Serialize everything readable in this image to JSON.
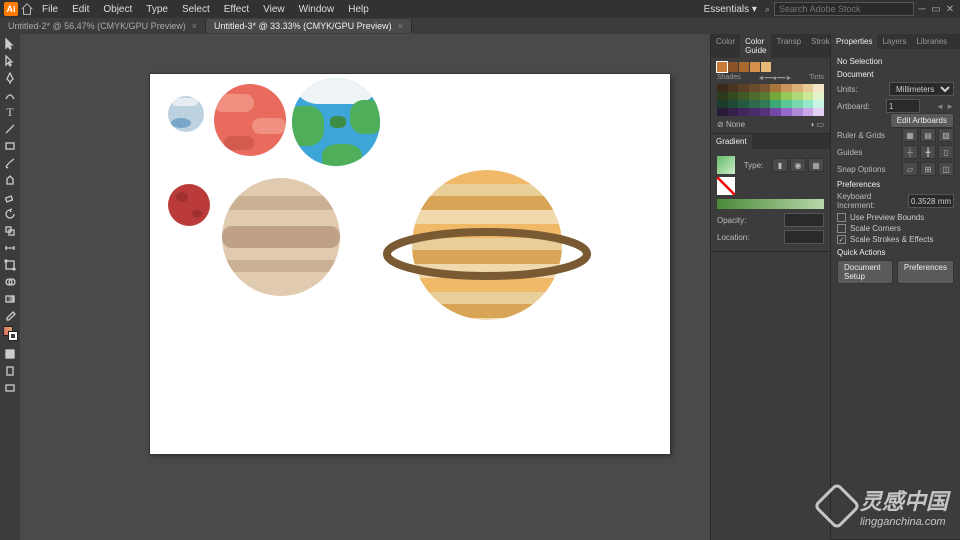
{
  "app": {
    "abbr": "Ai"
  },
  "menu": [
    "File",
    "Edit",
    "Object",
    "Type",
    "Select",
    "Effect",
    "View",
    "Window",
    "Help"
  ],
  "workspace": "Essentials",
  "search_placeholder": "Search Adobe Stock",
  "tabs": [
    {
      "label": "Untitled-2* @ 56.47% (CMYK/GPU Preview)",
      "active": false
    },
    {
      "label": "Untitled-3* @ 33.33% (CMYK/GPU Preview)",
      "active": true
    }
  ],
  "panels": {
    "color": {
      "tabs": [
        "Color",
        "Color Guide",
        "Transp",
        "Stroke"
      ],
      "active": "Color Guide",
      "slider_left": "Shades",
      "slider_right": "Tints",
      "none_label": "None"
    },
    "gradient": {
      "title": "Gradient",
      "type_label": "Type:",
      "opacity_label": "Opacity:",
      "location_label": "Location:"
    },
    "properties": {
      "tabs": [
        "Properties",
        "Layers",
        "Libraries"
      ],
      "active": "Properties",
      "noselection": "No Selection",
      "document": "Document",
      "units_label": "Units:",
      "units_value": "Millimeters",
      "artboard_label": "Artboard:",
      "artboard_value": "1",
      "edit_artboards": "Edit Artboards",
      "ruler_grids": "Ruler & Grids",
      "guides": "Guides",
      "snap_options": "Snap Options",
      "preferences": "Preferences",
      "keyboard_inc_label": "Keyboard Increment:",
      "keyboard_inc_value": "0.3528 mm",
      "chk_preview": "Use Preview Bounds",
      "chk_corners": "Scale Corners",
      "chk_strokes": "Scale Strokes & Effects",
      "quick_actions": "Quick Actions",
      "doc_setup": "Document Setup",
      "prefs_btn": "Preferences"
    }
  },
  "watermark": {
    "text": "灵感中国",
    "sub": "lingganchina.com"
  }
}
